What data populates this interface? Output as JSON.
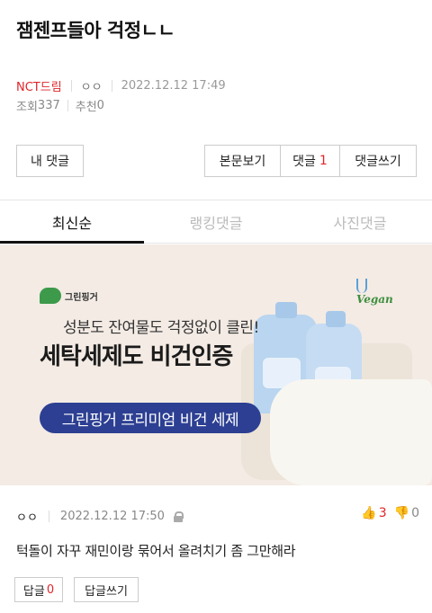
{
  "post": {
    "title": "잼젠프들아 걱정ㄴㄴ",
    "category": "NCT드림",
    "author": "ㅇㅇ",
    "datetime": "2022.12.12 17:49",
    "views_label": "조회",
    "views": "337",
    "recommend_label": "추천",
    "recommend": "0"
  },
  "actions": {
    "my_comments": "내 댓글",
    "view_post": "본문보기",
    "comments_label": "댓글",
    "comments_count": "1",
    "write_comment": "댓글쓰기"
  },
  "tabs": [
    {
      "label": "최신순",
      "active": true
    },
    {
      "label": "랭킹댓글",
      "active": false
    },
    {
      "label": "사진댓글",
      "active": false
    }
  ],
  "ad": {
    "brand": "그린핑거",
    "vegan_mark": "Vegan",
    "line1": "성분도 잔여물도 걱정없이 클린!",
    "line2": "세탁세제도 비건인증",
    "pill": "그린핑거 프리미엄 비건 세제"
  },
  "comment": {
    "author": "ㅇㅇ",
    "datetime": "2022.12.12 17:50",
    "upvotes": "3",
    "downvotes": "0",
    "text": "턱돌이 자꾸 재민이랑 묶어서 올려치기 좀 그만해라",
    "reply_label": "답글",
    "reply_count": "0",
    "write_reply": "답글쓰기"
  },
  "colors": {
    "accent": "#e0252a",
    "ad_pill": "#2c3f92"
  }
}
